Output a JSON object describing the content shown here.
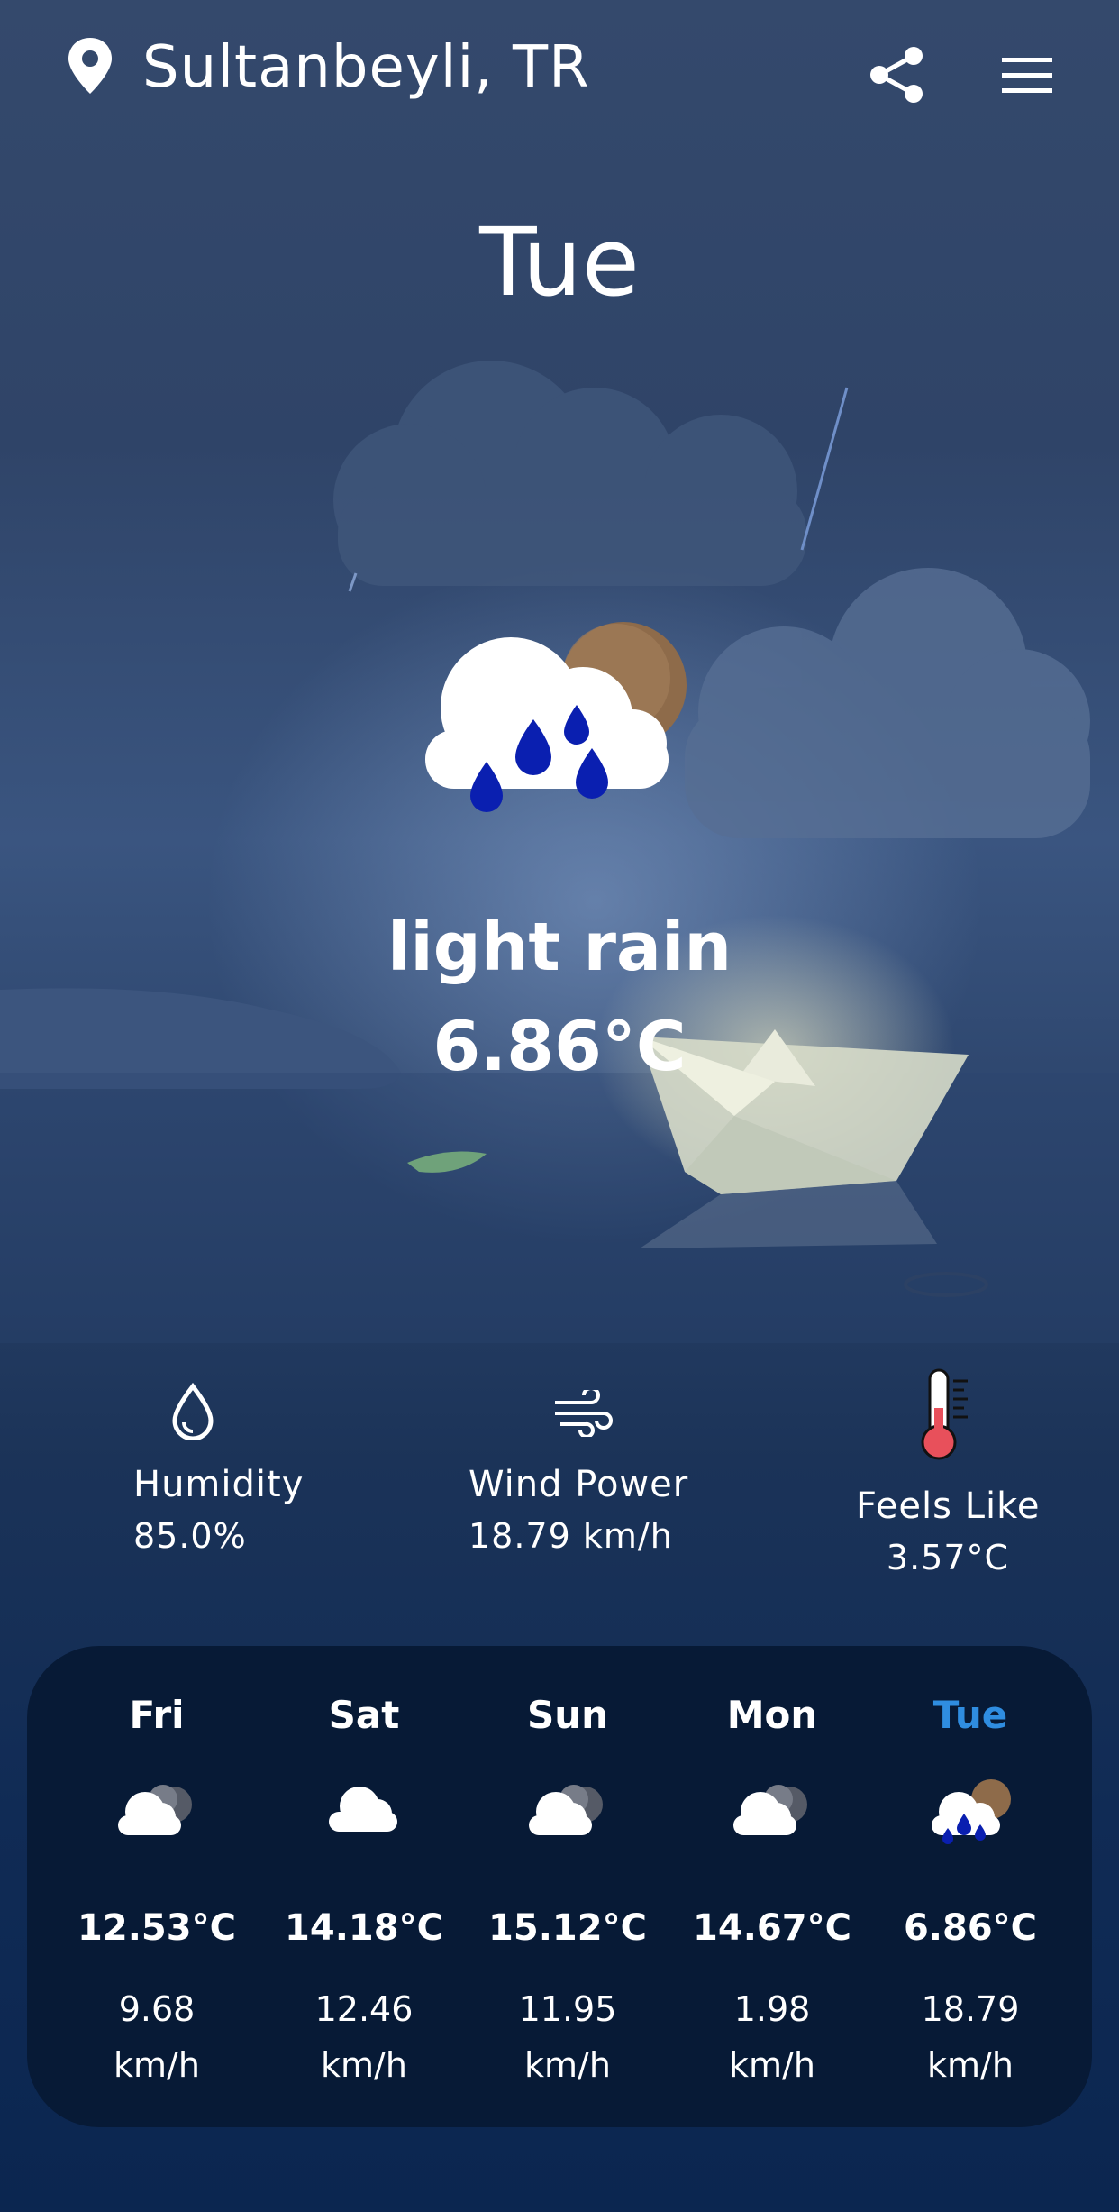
{
  "header": {
    "location": "Sultanbeyli, TR"
  },
  "current": {
    "day": "Tue",
    "condition": "light rain",
    "temperature": "6.86°C",
    "icon": "rain-sun-cloud-icon"
  },
  "stats": {
    "humidity": {
      "label": "Humidity",
      "value": "85.0%",
      "icon": "droplet-icon"
    },
    "wind": {
      "label": "Wind Power",
      "value": "18.79 km/h",
      "icon": "wind-icon"
    },
    "feels_like": {
      "label": "Feels Like",
      "value": "3.57°C",
      "icon": "thermometer-icon"
    }
  },
  "forecast": [
    {
      "day": "Fri",
      "temp": "12.53°C",
      "wind": "9.68",
      "unit": "km/h",
      "icon": "partly-cloudy-icon",
      "active": false
    },
    {
      "day": "Sat",
      "temp": "14.18°C",
      "wind": "12.46",
      "unit": "km/h",
      "icon": "cloud-icon",
      "active": false
    },
    {
      "day": "Sun",
      "temp": "15.12°C",
      "wind": "11.95",
      "unit": "km/h",
      "icon": "partly-cloudy-icon",
      "active": false
    },
    {
      "day": "Mon",
      "temp": "14.67°C",
      "wind": "1.98",
      "unit": "km/h",
      "icon": "partly-cloudy-icon",
      "active": false
    },
    {
      "day": "Tue",
      "temp": "6.86°C",
      "wind": "18.79",
      "unit": "km/h",
      "icon": "rain-sun-cloud-icon",
      "active": true
    }
  ],
  "colors": {
    "active_day": "#2f8de0",
    "card_bg": "#071a36",
    "rain_drop": "#0a1fb0"
  }
}
